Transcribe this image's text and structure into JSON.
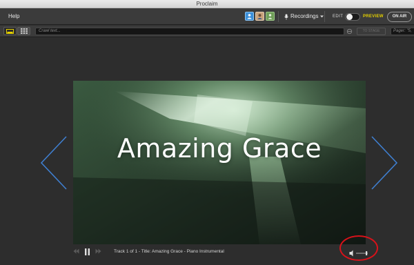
{
  "window": {
    "title": "Proclaim"
  },
  "menubar": {
    "help_label": "Help",
    "avatars": [
      "person-icon",
      "user-photo",
      "group-icon"
    ],
    "recordings_label": "Recordings",
    "edit_label": "EDIT",
    "preview_label": "PREVIEW",
    "onair_label": "ON AIR",
    "preview_accent": "#e5d100"
  },
  "toolbar": {
    "crawl_placeholder": "Crawl text...",
    "to_stage_label": "TO STAGE",
    "pager_placeholder": "Pager: \"5,"
  },
  "slide": {
    "title": "Amazing Grace",
    "background": "green light-beam image"
  },
  "transport": {
    "track_info": "Track 1 of 1 - Title: Amazing Grace - Piano Instrumental"
  },
  "annotation": {
    "color": "#d8121a"
  }
}
